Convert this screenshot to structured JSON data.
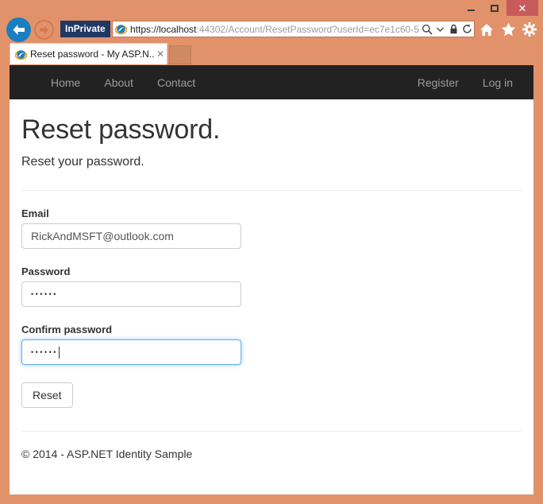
{
  "browser": {
    "window_controls": {
      "minimize_label": "–",
      "maximize_label": "□",
      "close_label": "✕"
    },
    "back_label": "←",
    "forward_label": "→",
    "inprivate_badge": "InPrivate",
    "url": {
      "scheme_and_host": "https://localhost",
      "rest": ":44302/Account/ResetPassword?userId=ec7e1c60-5"
    },
    "address_icons": {
      "search": "search-icon",
      "dropdown": "chevron-down-icon",
      "lock": "lock-icon",
      "refresh": "refresh-icon"
    },
    "toolbar_icons": {
      "home": "home-icon",
      "favorites": "star-icon",
      "settings": "gear-icon"
    },
    "tab": {
      "title": "Reset password - My ASP.N...",
      "close_label": "✕"
    }
  },
  "site": {
    "nav_left": [
      {
        "label": "Home"
      },
      {
        "label": "About"
      },
      {
        "label": "Contact"
      }
    ],
    "nav_right": [
      {
        "label": "Register"
      },
      {
        "label": "Log in"
      }
    ]
  },
  "page": {
    "title": "Reset password.",
    "subtitle": "Reset your password.",
    "form": {
      "email": {
        "label": "Email",
        "value": "RickAndMSFT@outlook.com",
        "placeholder": ""
      },
      "password": {
        "label": "Password",
        "value": "••••••",
        "placeholder": ""
      },
      "confirm_password": {
        "label": "Confirm password",
        "value": "••••••",
        "placeholder": "",
        "focused": true
      },
      "submit_label": "Reset"
    },
    "footer": "© 2014 - ASP.NET Identity Sample"
  },
  "colors": {
    "window_frame": "#e2926a",
    "close_button": "#c75b5b",
    "navbar": "#222222",
    "navbar_link": "#9d9d9d",
    "inprivate_badge": "#1f3864",
    "focus_border": "#66afe9",
    "back_button": "#1a7fc1"
  }
}
